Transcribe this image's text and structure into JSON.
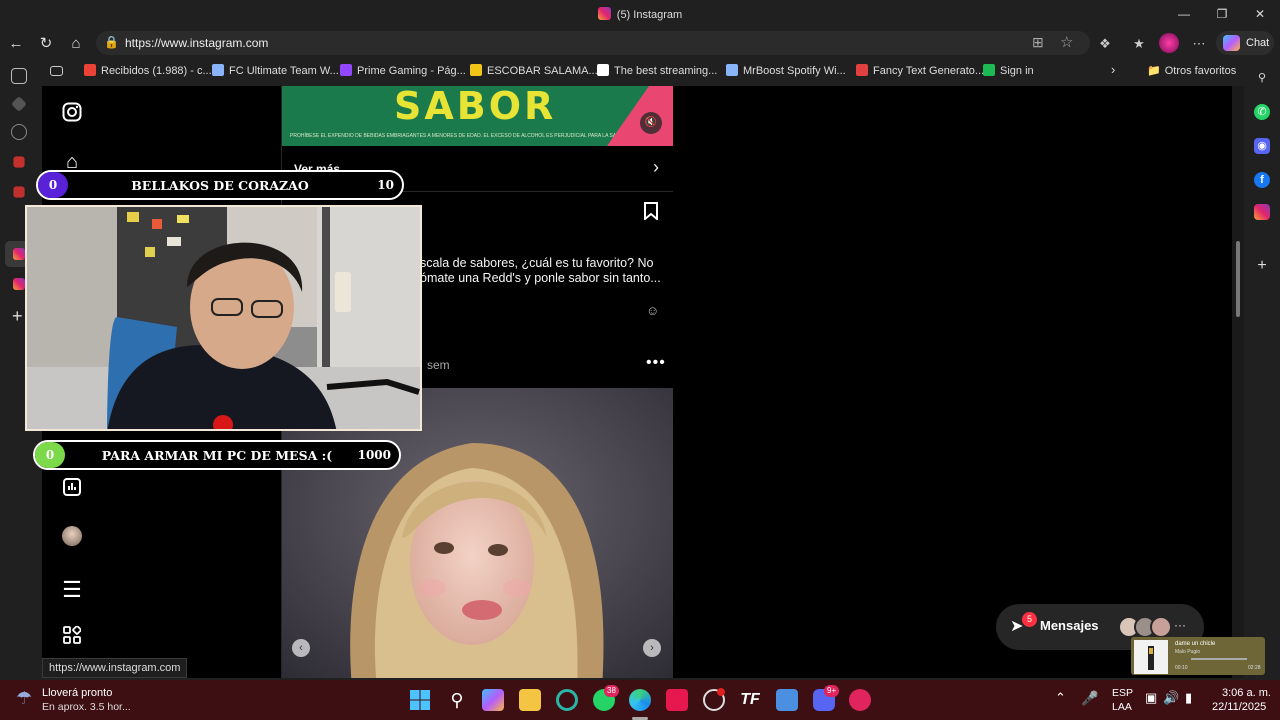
{
  "window": {
    "title": "(5) Instagram"
  },
  "address_bar": {
    "url": "https://www.instagram.com"
  },
  "toolbar": {
    "chat_label": "Chat"
  },
  "bookmarks": [
    {
      "label": "Recibidos (1.988) - c...",
      "icon": "gmail-icon",
      "color": "#ea4335"
    },
    {
      "label": "FC Ultimate Team W...",
      "icon": "globe-icon",
      "color": "#8ab4f8"
    },
    {
      "label": "Prime Gaming - Pág...",
      "icon": "prime-gaming-icon",
      "color": "#9146ff"
    },
    {
      "label": "ESCOBAR SALAMA...",
      "icon": "bookmark-icon",
      "color": "#f0c419"
    },
    {
      "label": "The best streaming...",
      "icon": "diamond-icon",
      "color": "#ffffff"
    },
    {
      "label": "MrBoost Spotify Wi...",
      "icon": "globe-icon",
      "color": "#8ab4f8"
    },
    {
      "label": "Fancy Text Generato...",
      "icon": "text-icon",
      "color": "#e04040"
    },
    {
      "label": "Sign in",
      "icon": "bat-icon",
      "color": "#1db954"
    }
  ],
  "other_favorites": "Otros favoritos",
  "ad": {
    "headline": "SABOR",
    "legal": "PROHÍBESE EL EXPENDIO DE BEBIDAS EMBRIAGANTES A MENORES DE EDAD. EL EXCESO DE ALCOHOL ES PERJUDICIAL PARA LA SALUD.",
    "cta": "Ver más"
  },
  "post": {
    "caption_line1": "scala de sabores, ¿cuál es tu favorito? No",
    "caption_line2": "ómate una Redd's y ponle sabor sin tanto...",
    "time": "sem",
    "more": "•••"
  },
  "messages": {
    "label": "Mensajes",
    "badge": "5",
    "more": "···"
  },
  "status_url": "https://www.instagram.com",
  "overlay": {
    "goal1": {
      "current": "0",
      "name": "BELLAKOS DE CORAZAO",
      "target": "10",
      "color": "#5a22d8"
    },
    "goal2": {
      "current": "0",
      "name": "PARA ARMAR MI PC DE MESA :(",
      "target": "1000",
      "color": "#7bd94a"
    }
  },
  "music": {
    "song": "dame un chicle",
    "artist": "Malo Pugio",
    "elapsed": "00:10",
    "duration": "02:28"
  },
  "taskbar": {
    "weather_title": "Lloverá pronto",
    "weather_sub": "En aprox. 3.5 hor...",
    "whatsapp_badge": "38",
    "discord_badge": "9+",
    "lang1": "ESP",
    "lang2": "LAA",
    "time": "3:06 a. m.",
    "date": "22/11/2025"
  }
}
